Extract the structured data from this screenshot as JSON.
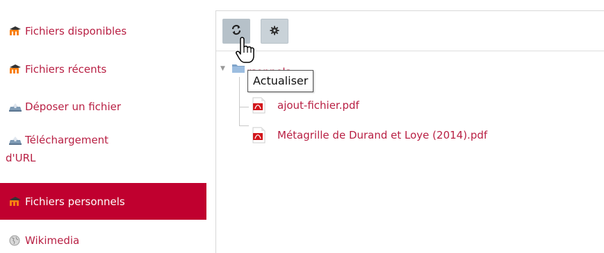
{
  "sidebar": {
    "items": [
      {
        "label": "Fichiers disponibles",
        "icon": "moodle-logo-icon",
        "active": false
      },
      {
        "label": "Fichiers récents",
        "icon": "moodle-logo-icon",
        "active": false
      },
      {
        "label": "Déposer un fichier",
        "icon": "upload-icon",
        "active": false
      },
      {
        "label": "Téléchargement d'URL",
        "label_line1": "Téléchargement",
        "label_line2": "d'URL",
        "icon": "url-download-icon",
        "active": false
      },
      {
        "label": "Fichiers personnels",
        "icon": "moodle-logo-icon",
        "active": true
      },
      {
        "label": "Wikimedia",
        "icon": "wikimedia-globe-icon",
        "active": false
      }
    ]
  },
  "toolbar": {
    "refresh_icon": "refresh-icon",
    "settings_icon": "gear-icon"
  },
  "tooltip": {
    "text": "Actualiser"
  },
  "tree": {
    "root_label_visible": "rsonnels",
    "root_icon": "folder-icon",
    "files": [
      {
        "name": "ajout-fichier.pdf",
        "icon": "pdf-file-icon"
      },
      {
        "name": "Métagrille de Durand et Loye (2014).pdf",
        "icon": "pdf-file-icon"
      }
    ]
  },
  "colors": {
    "accent": "#c0002f",
    "link": "#b81f43",
    "button_bg": "#c9d2d8"
  }
}
